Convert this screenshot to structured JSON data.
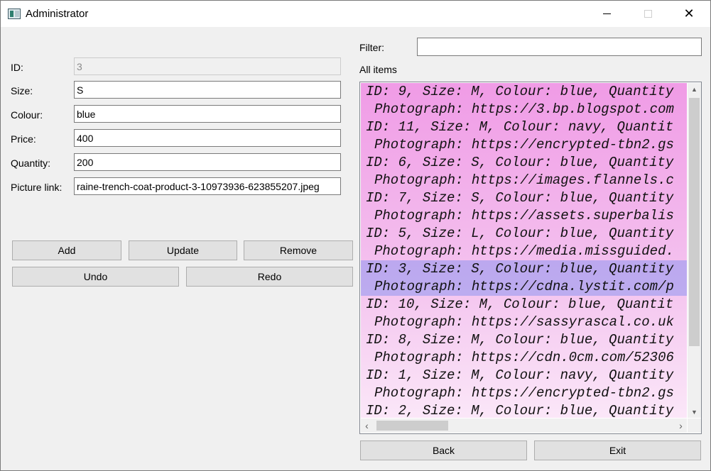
{
  "window": {
    "title": "Administrator",
    "minimize_glyph": "",
    "close_glyph": "✕"
  },
  "form": {
    "id_label": "ID:",
    "id_value": "3",
    "size_label": "Size:",
    "size_value": "S",
    "colour_label": "Colour:",
    "colour_value": "blue",
    "price_label": "Price:",
    "price_value": "400",
    "quantity_label": "Quantity:",
    "quantity_value": "200",
    "picture_label": "Picture link:",
    "picture_value": "raine-trench-coat-product-3-10973936-623855207.jpeg"
  },
  "actions": {
    "add": "Add",
    "update": "Update",
    "remove": "Remove",
    "undo": "Undo",
    "redo": "Redo",
    "back": "Back",
    "exit": "Exit"
  },
  "filter": {
    "label": "Filter:",
    "value": ""
  },
  "list": {
    "heading": "All items",
    "colors": {
      "gradient_top": "#f09be6",
      "gradient_bottom": "#fbe7f8",
      "selection": "#b7b4f0"
    },
    "items": [
      {
        "line1": "ID: 9, Size: M, Colour: blue, Quantity",
        "line2": "Photograph: https://3.bp.blogspot.com",
        "selected": false
      },
      {
        "line1": "ID: 11, Size: M, Colour: navy, Quantit",
        "line2": "Photograph: https://encrypted-tbn2.gs",
        "selected": false
      },
      {
        "line1": "ID: 6, Size: S, Colour: blue, Quantity",
        "line2": "Photograph: https://images.flannels.c",
        "selected": false
      },
      {
        "line1": "ID: 7, Size: S, Colour: blue, Quantity",
        "line2": "Photograph: https://assets.superbalis",
        "selected": false
      },
      {
        "line1": "ID: 5, Size: L, Colour: blue, Quantity",
        "line2": "Photograph: https://media.missguided.",
        "selected": false
      },
      {
        "line1": "ID: 3, Size: S, Colour: blue, Quantity",
        "line2": "Photograph: https://cdna.lystit.com/p",
        "selected": true
      },
      {
        "line1": "ID: 10, Size: M, Colour: blue, Quantit",
        "line2": "Photograph: https://sassyrascal.co.uk",
        "selected": false
      },
      {
        "line1": "ID: 8, Size: M, Colour: blue, Quantity",
        "line2": "Photograph: https://cdn.0cm.com/52306",
        "selected": false
      },
      {
        "line1": "ID: 1, Size: M, Colour: navy, Quantity",
        "line2": "Photograph: https://encrypted-tbn2.gs",
        "selected": false
      },
      {
        "line1": "ID: 2, Size: M, Colour: blue, Quantity",
        "line2": "",
        "selected": false
      }
    ]
  },
  "icons": {
    "scroll_up": "▲",
    "scroll_down": "▼",
    "scroll_left": "‹",
    "scroll_right": "›"
  }
}
